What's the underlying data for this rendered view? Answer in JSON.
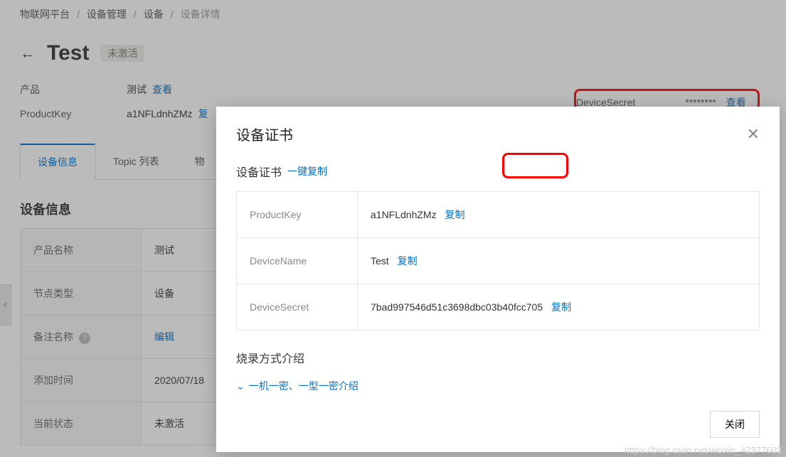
{
  "breadcrumb": {
    "items": [
      "物联网平台",
      "设备管理",
      "设备"
    ],
    "current": "设备详情",
    "sep": "/"
  },
  "header": {
    "back_symbol": "←",
    "title": "Test",
    "status": "未激活"
  },
  "summary": {
    "product_label": "产品",
    "product_value": "测试",
    "view_link": "查看",
    "productkey_label": "ProductKey",
    "productkey_value": "a1NFLdnhZMz",
    "copy_link": "复",
    "devicesecret_label": "DeviceSecret",
    "devicesecret_mask": "********",
    "devicesecret_view": "查看"
  },
  "tabs": {
    "t0": "设备信息",
    "t1": "Topic 列表",
    "t2": "物"
  },
  "section": {
    "title": "设备信息",
    "rows": {
      "product_name_label": "产品名称",
      "product_name_value": "测试",
      "node_type_label": "节点类型",
      "node_type_value": "设备",
      "note_name_label": "备注名称",
      "note_edit": "编辑",
      "add_time_label": "添加时间",
      "add_time_value": "2020/07/18",
      "cur_status_label": "当前状态",
      "cur_status_value": "未激活"
    },
    "help_icon": "?"
  },
  "edge_nav": "‹",
  "modal": {
    "title": "设备证书",
    "close_symbol": "✕",
    "subtitle": "设备证书",
    "copy_all": "一键复制",
    "cert": {
      "productkey_label": "ProductKey",
      "productkey_value": "a1NFLdnhZMz",
      "devicename_label": "DeviceName",
      "devicename_value": "Test",
      "devicesecret_label": "DeviceSecret",
      "devicesecret_value": "7bad997546d51c3698dbc03b40fcc705",
      "copy": "复制"
    },
    "burn_title": "烧录方式介绍",
    "expand_chevron": "⌄",
    "expand_text": "一机一密、一型一密介绍",
    "close_btn": "关闭"
  },
  "watermark": "https://blog.csdn.net/weixin_42377603"
}
